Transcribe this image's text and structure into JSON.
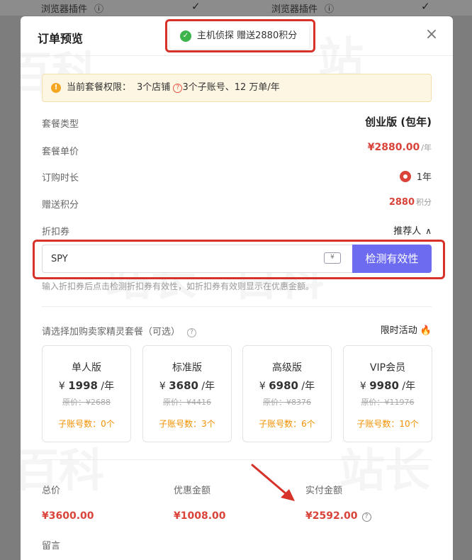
{
  "background": {
    "cells": [
      "浏览器插件",
      "浏览器插件"
    ],
    "check": "✓"
  },
  "modal": {
    "title": "订单预览",
    "close": "×"
  },
  "toast": {
    "text": "主机侦探 赠送2880积分"
  },
  "notice": {
    "label": "当前套餐权限：",
    "part1": "3个店铺",
    "part2": "3个子账号、12 万单/年"
  },
  "order": {
    "plan_type_label": "套餐类型",
    "plan_type_value": "创业版 (包年)",
    "unit_price_label": "套餐单价",
    "unit_price_value": "¥2880.00",
    "unit_price_unit": "/年",
    "duration_label": "订购时长",
    "duration_value": "1年",
    "points_label": "赠送积分",
    "points_value": "2880",
    "points_unit": "积分",
    "coupon_label": "折扣券",
    "recommender_label": "推荐人"
  },
  "coupon": {
    "value": "SPY",
    "check_button": "检测有效性",
    "hint": "输入折扣券后点击检测折扣券有效性，如折扣券有效则显示在优惠金额。"
  },
  "addon": {
    "title": "请选择加购卖家精灵套餐（可选）",
    "limited": "限时活动",
    "packages": [
      {
        "name": "单人版",
        "price": "1998",
        "orig": "原价：¥2688",
        "sub": "子账号数：0个"
      },
      {
        "name": "标准版",
        "price": "3680",
        "orig": "原价：¥4416",
        "sub": "子账号数：3个"
      },
      {
        "name": "高级版",
        "price": "6980",
        "orig": "原价：¥8376",
        "sub": "子账号数：6个"
      },
      {
        "name": "VIP会员",
        "price": "9980",
        "orig": "原价：¥11976",
        "sub": "子账号数：10个"
      }
    ],
    "currency": "¥",
    "per_year": "/年"
  },
  "totals": {
    "total_label": "总价",
    "total_value": "¥3600.00",
    "discount_label": "优惠金额",
    "discount_value": "¥1008.00",
    "paid_label": "实付金额",
    "paid_value": "¥2592.00"
  },
  "note_label": "留言",
  "colors": {
    "accent": "#6d6bf0",
    "price_red": "#d9433a",
    "highlight": "#d6322a",
    "warning": "#f29100"
  }
}
